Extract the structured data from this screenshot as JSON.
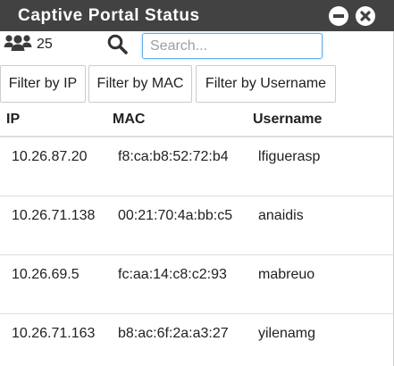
{
  "window": {
    "title": "Captive Portal Status"
  },
  "toolbar": {
    "user_count": "25",
    "search_placeholder": "Search..."
  },
  "filters": {
    "by_ip": "Filter by IP",
    "by_mac": "Filter by MAC",
    "by_username": "Filter by Username"
  },
  "table": {
    "columns": [
      "IP",
      "MAC",
      "Username"
    ],
    "rows": [
      {
        "ip": "10.26.87.20",
        "mac": "f8:ca:b8:52:72:b4",
        "username": "lfiguerasp"
      },
      {
        "ip": "10.26.71.138",
        "mac": "00:21:70:4a:bb:c5",
        "username": "anaidis"
      },
      {
        "ip": "10.26.69.5",
        "mac": "fc:aa:14:c8:c2:93",
        "username": "mabreuo"
      },
      {
        "ip": "10.26.71.163",
        "mac": "b8:ac:6f:2a:a3:27",
        "username": "yilenamg"
      }
    ]
  },
  "icons": {
    "users": "users-icon",
    "search": "search-icon",
    "minimize": "minus-circle-icon",
    "close": "close-circle-icon"
  },
  "colors": {
    "titlebar_bg": "#424242",
    "titlebar_text": "#ffffff",
    "input_focus_border": "#66afe9"
  }
}
